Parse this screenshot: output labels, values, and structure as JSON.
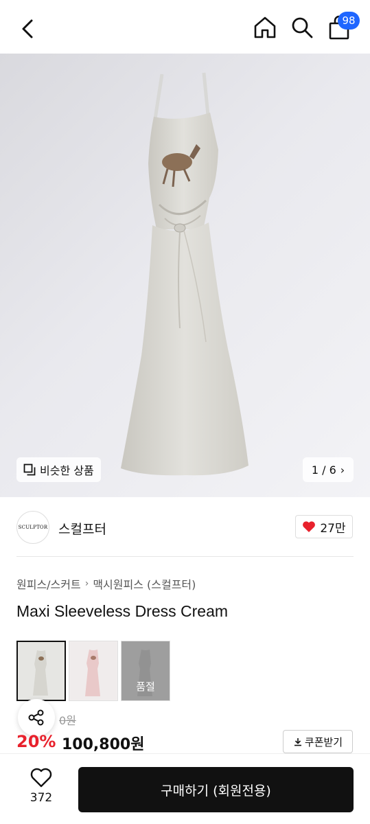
{
  "header": {
    "cart_count": "98"
  },
  "hero": {
    "similar_label": "비슷한 상품",
    "pager": "1 / 6"
  },
  "brand": {
    "logo_text": "SCULPTOR",
    "name": "스컬프터",
    "likes": "27만"
  },
  "product": {
    "breadcrumb": [
      "원피스/스커트",
      "맥시원피스 (스컬프터)"
    ],
    "title": "Maxi Sleeveless Dress Cream",
    "swatches": [
      {
        "state": "selected",
        "color": "#e6e6e3"
      },
      {
        "state": "available",
        "color": "#f0dada"
      },
      {
        "state": "soldout",
        "color": "#bdbdbd",
        "label": "품절"
      }
    ],
    "original_price": "0원",
    "discount": "20%",
    "price": "100,800원",
    "coupon_label": "쿠폰받기"
  },
  "bottom": {
    "wish_count": "372",
    "buy_label": "구매하기 (회원전용)"
  },
  "colors": {
    "accent_blue": "#1f66ff",
    "discount_red": "#e8212c",
    "heart_red": "#e8212c",
    "buy_bg": "#111111"
  }
}
